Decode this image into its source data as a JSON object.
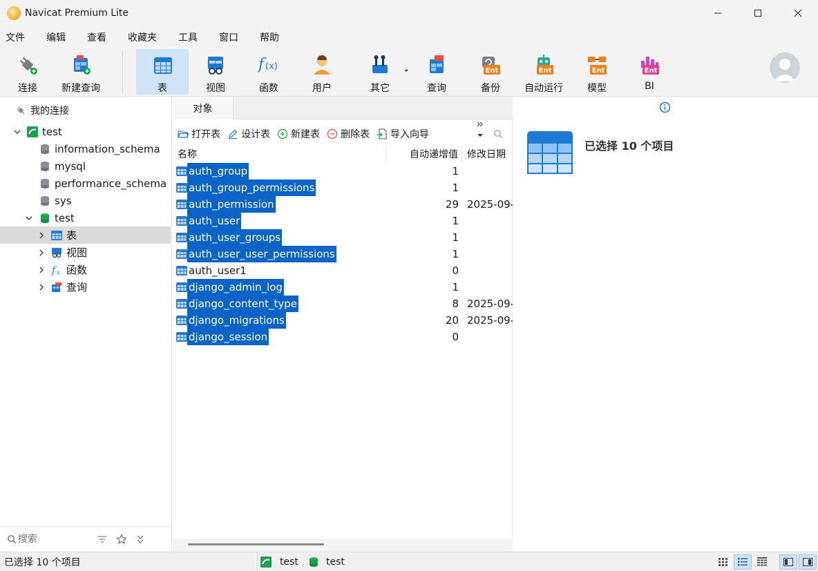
{
  "window": {
    "title": "Navicat Premium Lite"
  },
  "menu": [
    "文件",
    "编辑",
    "查看",
    "收藏夹",
    "工具",
    "窗口",
    "帮助"
  ],
  "toolbar": {
    "connect": "连接",
    "new_query": "新建查询",
    "table": "表",
    "view": "视图",
    "function": "函数",
    "user": "用户",
    "other": "其它",
    "query": "查询",
    "backup": "备份",
    "automation": "自动运行",
    "model": "模型",
    "bi": "BI",
    "ent_badge": "Ent"
  },
  "nav": {
    "header": "我的连接",
    "connection": "test",
    "databases": [
      "information_schema",
      "mysql",
      "performance_schema",
      "sys",
      "test"
    ],
    "children": {
      "tables": "表",
      "views": "视图",
      "functions": "函数",
      "queries": "查询"
    },
    "search_placeholder": "搜索"
  },
  "objects": {
    "tab": "对象",
    "toolbar": {
      "open": "打开表",
      "design": "设计表",
      "new": "新建表",
      "delete": "删除表",
      "import": "导入向导"
    },
    "columns": {
      "name": "名称",
      "auto_inc": "自动递增值",
      "modified": "修改日期"
    },
    "rows": [
      {
        "name": "auth_group",
        "inc": "1",
        "date": "",
        "selected": true
      },
      {
        "name": "auth_group_permissions",
        "inc": "1",
        "date": "",
        "selected": true
      },
      {
        "name": "auth_permission",
        "inc": "29",
        "date": "2025-09-",
        "selected": true
      },
      {
        "name": "auth_user",
        "inc": "1",
        "date": "",
        "selected": true
      },
      {
        "name": "auth_user_groups",
        "inc": "1",
        "date": "",
        "selected": true
      },
      {
        "name": "auth_user_user_permissions",
        "inc": "1",
        "date": "",
        "selected": true
      },
      {
        "name": "auth_user1",
        "inc": "0",
        "date": "",
        "selected": false
      },
      {
        "name": "django_admin_log",
        "inc": "1",
        "date": "",
        "selected": true
      },
      {
        "name": "django_content_type",
        "inc": "8",
        "date": "2025-09-",
        "selected": true
      },
      {
        "name": "django_migrations",
        "inc": "20",
        "date": "2025-09-",
        "selected": true
      },
      {
        "name": "django_session",
        "inc": "0",
        "date": "",
        "selected": true
      }
    ]
  },
  "info": {
    "selected_text": "已选择 10 个项目"
  },
  "status": {
    "selected_text": "已选择 10 个项目",
    "connection": "test",
    "database": "test"
  },
  "colors": {
    "accent": "#0a64c8",
    "active_tool": "#cfe4f7",
    "db_green": "#1aa34a"
  }
}
